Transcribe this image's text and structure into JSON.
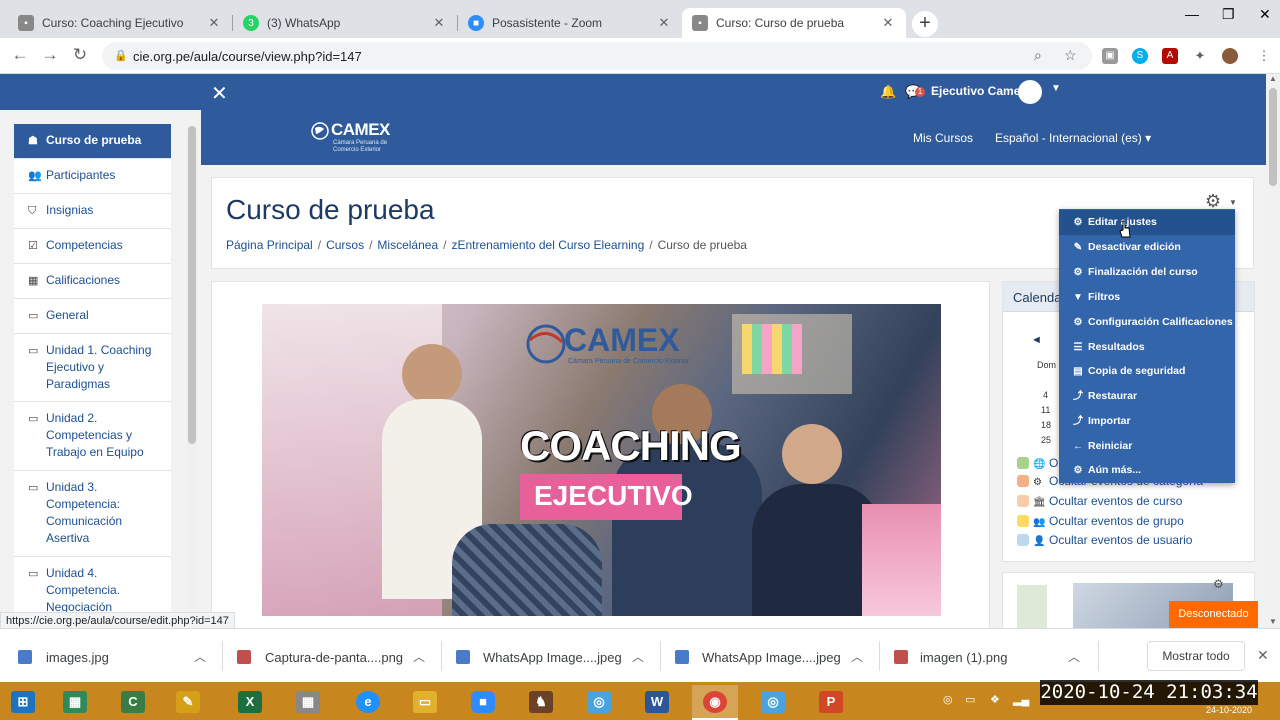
{
  "browser": {
    "tabs": [
      {
        "title": "Curso: Coaching Ejecutivo",
        "favicon": "moodle-icon",
        "color": "#777777",
        "glyph": ""
      },
      {
        "title": "(3) WhatsApp",
        "favicon": "whatsapp-icon",
        "color": "#25d366",
        "glyph": "3"
      },
      {
        "title": "Posasistente - Zoom",
        "favicon": "zoom-icon",
        "color": "#2d8cff",
        "glyph": "■"
      },
      {
        "title": "Curso: Curso de prueba",
        "favicon": "moodle-icon",
        "color": "#777777",
        "glyph": ""
      }
    ],
    "new_tab": "+",
    "url": "cie.org.pe/aula/course/view.php?id=147"
  },
  "topbar": {
    "user_name": "Ejecutivo Camex",
    "message_count": "1"
  },
  "header": {
    "logo_text": "CAMEX",
    "logo_sub": "Cámara Peruana de Comercio Exterior",
    "mis_cursos": "Mis Cursos",
    "language": "Español - Internacional (es)"
  },
  "sidebar": {
    "items": [
      {
        "label": "Curso de prueba",
        "icon": "graduation-cap-icon",
        "glyph": "☗"
      },
      {
        "label": "Participantes",
        "icon": "users-icon",
        "glyph": "👥"
      },
      {
        "label": "Insignias",
        "icon": "shield-icon",
        "glyph": "⛉"
      },
      {
        "label": "Competencias",
        "icon": "checkbox-icon",
        "glyph": "☑"
      },
      {
        "label": "Calificaciones",
        "icon": "table-icon",
        "glyph": "▦"
      },
      {
        "label": "General",
        "icon": "folder-icon",
        "glyph": "▭"
      },
      {
        "label": "Unidad 1. Coaching Ejecutivo y Paradigmas",
        "icon": "folder-icon",
        "glyph": "▭"
      },
      {
        "label": "Unidad 2. Competencias y Trabajo en Equipo",
        "icon": "folder-icon",
        "glyph": "▭"
      },
      {
        "label": "Unidad 3. Competencia: Comunicación Asertiva",
        "icon": "folder-icon",
        "glyph": "▭"
      },
      {
        "label": "Unidad 4. Competencia. Negociación",
        "icon": "folder-icon",
        "glyph": "▭"
      }
    ]
  },
  "page": {
    "title": "Curso de prueba",
    "breadcrumb": [
      "Página Principal",
      "Cursos",
      "Miscelánea",
      "zEntrenamiento del Curso Elearning",
      "Curso de prueba"
    ],
    "breadcrumb_sep": "/"
  },
  "banner": {
    "brand": "CAMEX",
    "brand_sub": "Cámara Peruana de Comercio Exterior",
    "headline": "COACHING",
    "subline": "EJECUTIVO"
  },
  "admin_menu": {
    "items": [
      {
        "label": "Editar ajustes",
        "icon": "gear-icon",
        "glyph": "⚙"
      },
      {
        "label": "Desactivar edición",
        "icon": "pencil-icon",
        "glyph": "✎"
      },
      {
        "label": "Finalización del curso",
        "icon": "gear-icon",
        "glyph": "⚙"
      },
      {
        "label": "Filtros",
        "icon": "filter-icon",
        "glyph": "▼"
      },
      {
        "label": "Configuración Calificaciones",
        "icon": "gear-icon",
        "glyph": "⚙"
      },
      {
        "label": "Resultados",
        "icon": "list-icon",
        "glyph": "☰"
      },
      {
        "label": "Copia de seguridad",
        "icon": "file-icon",
        "glyph": "▤"
      },
      {
        "label": "Restaurar",
        "icon": "upload-icon",
        "glyph": "⤴"
      },
      {
        "label": "Importar",
        "icon": "import-icon",
        "glyph": "⤴"
      },
      {
        "label": "Reiniciar",
        "icon": "arrow-left-icon",
        "glyph": "←"
      },
      {
        "label": "Aún más...",
        "icon": "gear-icon",
        "glyph": "⚙"
      }
    ]
  },
  "calendar": {
    "header": "Calenda",
    "prev": "◄",
    "day_label": "Dom",
    "dates": [
      "4",
      "11",
      "18",
      "25"
    ],
    "events": [
      {
        "label": "O",
        "eye_color": "#a9d18e",
        "glyph": "🌐"
      },
      {
        "label": "Ocultar eventos de categoría",
        "eye_color": "#f4b183",
        "glyph": "⚙"
      },
      {
        "label": "Ocultar eventos de curso",
        "eye_color": "#f8cbad",
        "glyph": "🏛"
      },
      {
        "label": "Ocultar eventos de grupo",
        "eye_color": "#ffd966",
        "glyph": "👥"
      },
      {
        "label": "Ocultar eventos de usuario",
        "eye_color": "#bdd7ee",
        "glyph": "👤"
      }
    ]
  },
  "status": {
    "hover_url": "https://cie.org.pe/aula/course/edit.php?id=147",
    "desconectado": "Desconectado"
  },
  "downloads": {
    "files": [
      {
        "name": "images.jpg",
        "color": "#4a7bc8"
      },
      {
        "name": "Captura-de-panta....png",
        "color": "#c0504d"
      },
      {
        "name": "WhatsApp Image....jpeg",
        "color": "#4a7bc8"
      },
      {
        "name": "WhatsApp Image....jpeg",
        "color": "#4a7bc8"
      },
      {
        "name": "imagen (1).png",
        "color": "#c0504d"
      }
    ],
    "show_all": "Mostrar todo"
  },
  "taskbar": {
    "apps": [
      {
        "name": "windows-start-icon",
        "color": "#1e73be",
        "glyph": "⊞"
      },
      {
        "name": "calculator-icon",
        "color": "#2e8b57",
        "glyph": "▦"
      },
      {
        "name": "camtasia-icon",
        "color": "#3a7d44",
        "glyph": "C"
      },
      {
        "name": "paint-icon",
        "color": "#d4a017",
        "glyph": "✎"
      },
      {
        "name": "excel-icon",
        "color": "#1d6f42",
        "glyph": "X"
      },
      {
        "name": "calculator2-icon",
        "color": "#888888",
        "glyph": "▦"
      },
      {
        "name": "edge-icon",
        "color": "#1e90ff",
        "glyph": "e"
      },
      {
        "name": "explorer-icon",
        "color": "#e1b12c",
        "glyph": "▭"
      },
      {
        "name": "zoom-icon",
        "color": "#2d8cff",
        "glyph": "■"
      },
      {
        "name": "game-icon",
        "color": "#6b4226",
        "glyph": "♞"
      },
      {
        "name": "box-icon",
        "color": "#4aa3df",
        "glyph": "◎"
      },
      {
        "name": "word-icon",
        "color": "#2b579a",
        "glyph": "W"
      },
      {
        "name": "chrome-icon",
        "color": "#db4437",
        "glyph": "◉"
      },
      {
        "name": "box2-icon",
        "color": "#4aa3df",
        "glyph": "◎"
      },
      {
        "name": "powerpoint-icon",
        "color": "#d24726",
        "glyph": "P"
      }
    ],
    "clock": "2020-10-24 21:03:34",
    "date": "24-10-2020"
  }
}
